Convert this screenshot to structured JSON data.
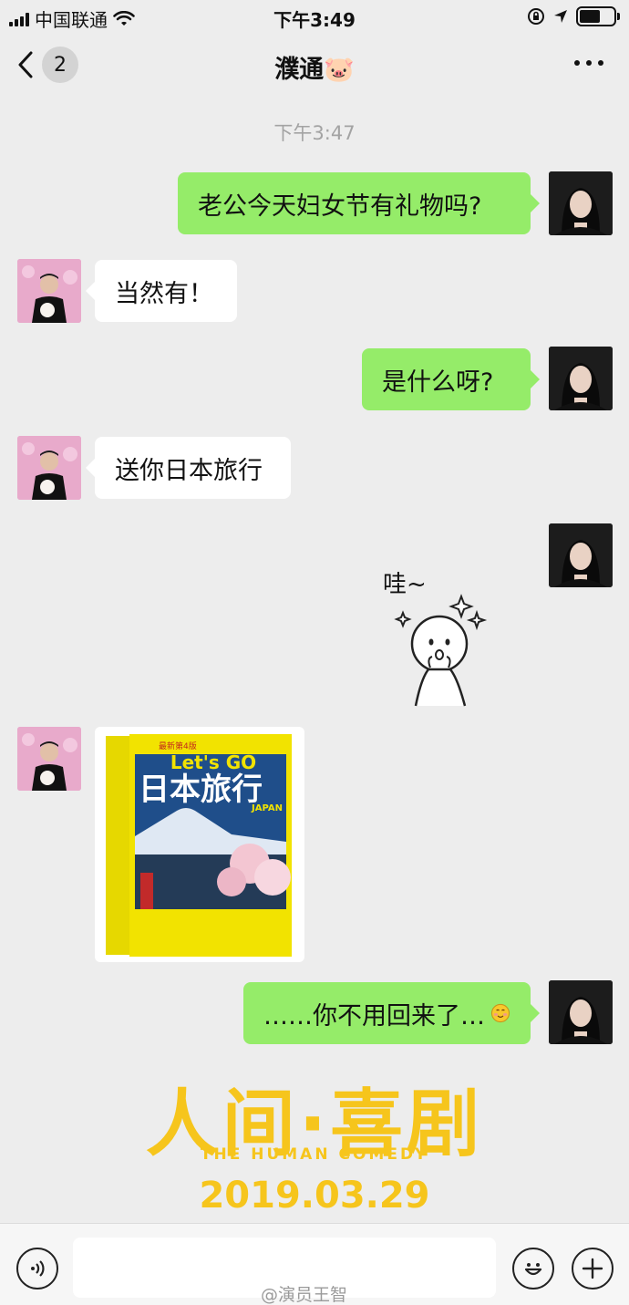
{
  "status_bar": {
    "carrier": "中国联通",
    "time": "下午3:49",
    "battery_level": 0.6
  },
  "nav": {
    "back_count": "2",
    "title": "濮通🐷"
  },
  "chat": {
    "timestamp": "下午3:47",
    "messages": [
      {
        "from": "me",
        "text": "老公今天妇女节有礼物吗?"
      },
      {
        "from": "them",
        "text": "当然有！"
      },
      {
        "from": "me",
        "text": "是什么呀?"
      },
      {
        "from": "them",
        "text": "送你日本旅行"
      },
      {
        "from": "me",
        "type": "sticker",
        "text": "哇~"
      },
      {
        "from": "them",
        "type": "image",
        "title": "日本旅行",
        "brand": "Let's GO",
        "edition": "最新第4版",
        "sub": "JAPAN"
      },
      {
        "from": "me",
        "text": "……你不用回来了…"
      }
    ]
  },
  "watermark": {
    "title": "人间·喜剧",
    "subtitle": "THE HUMAN COMEDY",
    "date": "2019.03.29"
  },
  "input_bar": {
    "credit": "@演员王智"
  },
  "colors": {
    "my_bubble": "#95ec69",
    "their_bubble": "#ffffff",
    "background": "#ededed",
    "poster_yellow": "#f6c51c"
  }
}
